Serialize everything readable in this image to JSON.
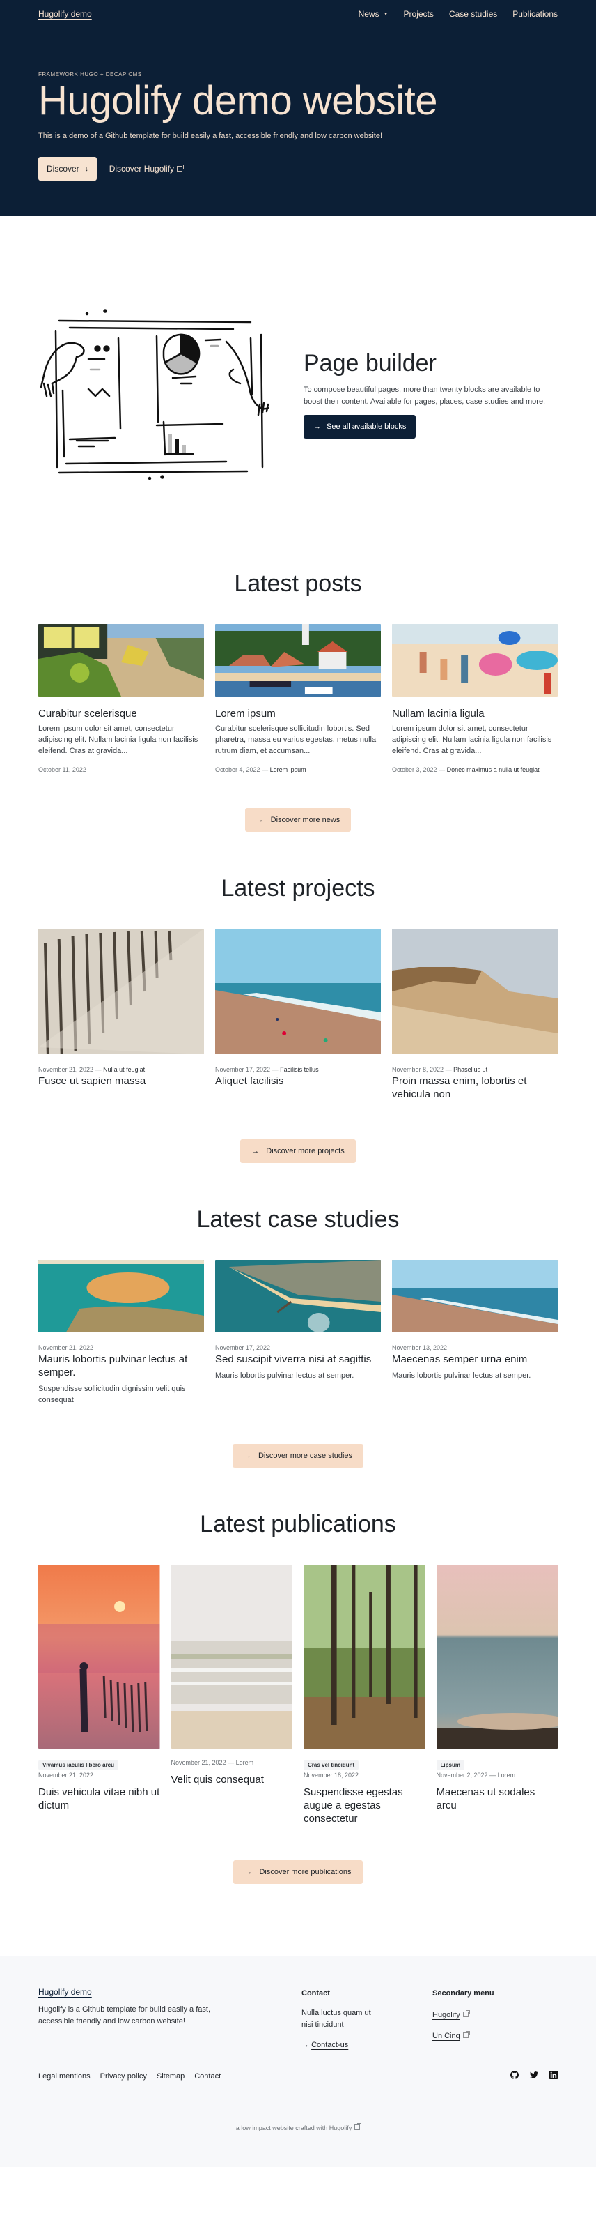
{
  "header": {
    "brand": "Hugolify demo",
    "nav": [
      {
        "label": "News",
        "has_dropdown": true
      },
      {
        "label": "Projects"
      },
      {
        "label": "Case studies"
      },
      {
        "label": "Publications"
      }
    ]
  },
  "hero": {
    "eyebrow": "FRAMEWORK HUGO + DECAP CMS",
    "title": "Hugolify demo website",
    "lead": "This is a demo of a Github template for build easily a fast, accessible friendly and low carbon website!",
    "primary_button": "Discover",
    "primary_icon": "↓",
    "secondary_link": "Discover Hugolify"
  },
  "builder": {
    "title": "Page builder",
    "text": "To compose beautiful pages, more than twenty blocks are available to boost their content. Available for pages, places, case studies and more.",
    "button": "See all available blocks",
    "button_icon": "→"
  },
  "posts": {
    "title": "Latest posts",
    "items": [
      {
        "title": "Curabitur scelerisque",
        "excerpt": "Lorem ipsum dolor sit amet, consectetur adipiscing elit. Nullam lacinia ligula non facilisis eleifend. Cras at gravida...",
        "date": "October 11, 2022",
        "category": ""
      },
      {
        "title": "Lorem ipsum",
        "excerpt": "Curabitur scelerisque sollicitudin lobortis. Sed pharetra, massa eu varius egestas, metus nulla rutrum diam, et accumsan...",
        "date": "October 4, 2022",
        "category": "— Lorem ipsum"
      },
      {
        "title": "Nullam lacinia ligula",
        "excerpt": "Lorem ipsum dolor sit amet, consectetur adipiscing elit. Nullam lacinia ligula non facilisis eleifend. Cras at gravida...",
        "date": "October 3, 2022",
        "category": "— Donec maximus a nulla ut feugiat"
      }
    ],
    "cta": "Discover more news",
    "cta_icon": "→"
  },
  "projects": {
    "title": "Latest projects",
    "items": [
      {
        "title": "Fusce ut sapien massa",
        "date": "November 21, 2022",
        "category": "— Nulla ut feugiat"
      },
      {
        "title": "Aliquet facilisis",
        "date": "November 17, 2022",
        "category": "— Facilisis tellus"
      },
      {
        "title": "Proin massa enim, lobortis et vehicula non",
        "date": "November 8, 2022",
        "category": "— Phasellus ut"
      }
    ],
    "cta": "Discover more projects",
    "cta_icon": "→"
  },
  "case_studies": {
    "title": "Latest case studies",
    "items": [
      {
        "title": "Mauris lobortis pulvinar lectus at semper.",
        "date": "November 21, 2022",
        "excerpt": "Suspendisse sollicitudin dignissim velit quis consequat"
      },
      {
        "title": "Sed suscipit viverra nisi at sagittis",
        "date": "November 17, 2022",
        "excerpt": "Mauris lobortis pulvinar lectus at semper."
      },
      {
        "title": "Maecenas semper urna enim",
        "date": "November 13, 2022",
        "excerpt": "Mauris lobortis pulvinar lectus at semper."
      }
    ],
    "cta": "Discover more case studies",
    "cta_icon": "→"
  },
  "publications": {
    "title": "Latest publications",
    "items": [
      {
        "tag": "Vivamus iaculis libero arcu",
        "date": "November 21, 2022",
        "category": "",
        "title": "Duis vehicula vitae nibh ut dictum"
      },
      {
        "tag": "",
        "date": "November 21, 2022",
        "category": "— Lorem",
        "title": "Velit quis consequat"
      },
      {
        "tag": "Cras vel tincidunt",
        "date": "November 18, 2022",
        "category": "",
        "title": "Suspendisse egestas augue a egestas consectetur"
      },
      {
        "tag": "Lipsum",
        "date": "November 2, 2022",
        "category": "— Lorem",
        "title": "Maecenas ut sodales arcu"
      }
    ],
    "cta": "Discover more publications",
    "cta_icon": "→"
  },
  "footer": {
    "brand": "Hugolify demo",
    "description": "Hugolify is a Github template for build easily a fast, accessible friendly and low carbon website!",
    "contact": {
      "heading": "Contact",
      "text": "Nulla luctus quam ut nisi tincidunt",
      "link": "Contact-us",
      "link_icon": "→"
    },
    "secondary_menu": {
      "heading": "Secondary menu",
      "links": [
        "Hugolify",
        "Un Cinq"
      ]
    },
    "legal_links": [
      "Legal mentions",
      "Privacy policy",
      "Sitemap",
      "Contact"
    ],
    "social": [
      "github-icon",
      "twitter-icon",
      "linkedin-icon"
    ],
    "credit_text": "a low impact website crafted with",
    "credit_link": "Hugolify"
  },
  "colors": {
    "navy": "#0c1f36",
    "cream": "#f7e3d1",
    "peach": "#f7dcc7",
    "text": "#1f2328",
    "footer_bg": "#f7f8fa"
  }
}
